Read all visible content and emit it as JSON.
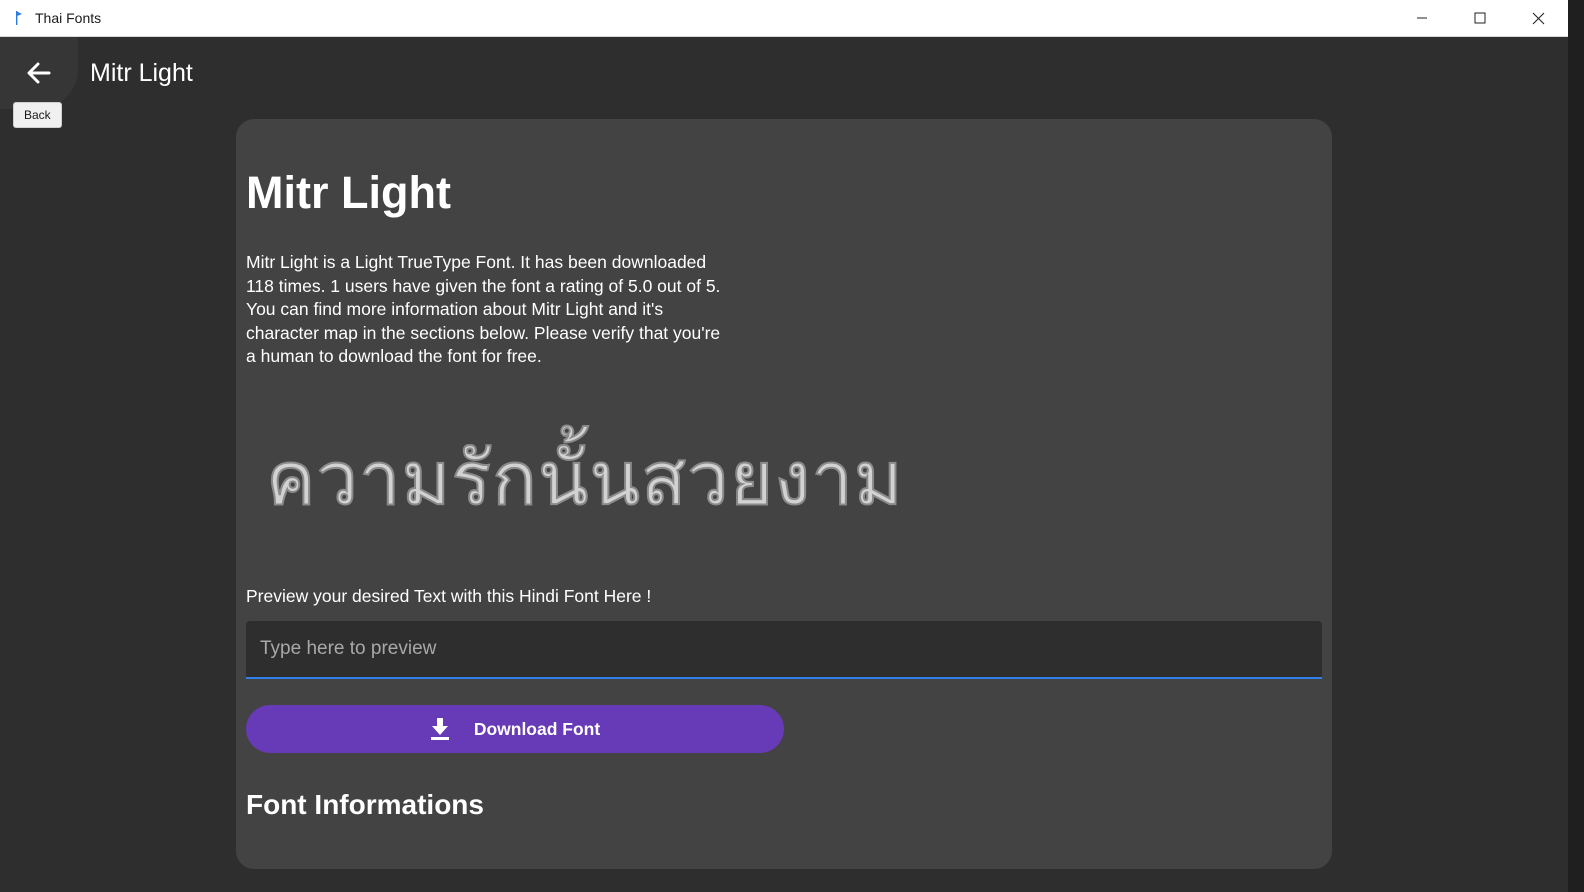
{
  "window": {
    "title": "Thai Fonts",
    "icon": "app-icon",
    "controls": [
      "minimize-icon",
      "maximize-icon",
      "close-icon"
    ]
  },
  "header": {
    "back_icon": "arrow-left-icon",
    "back_tooltip": "Back",
    "page_title": "Mitr Light"
  },
  "card": {
    "font_title": "Mitr Light",
    "description": "Mitr Light is a Light TrueType Font. It has been downloaded 118 times. 1 users have given the font a rating of 5.0 out of 5. You can find more information about Mitr Light and it's character map in the sections below. Please verify that you're a human to download the font for free.",
    "sample_text": "ความรักนั้นสวยงาม",
    "preview_label": "Preview your desired Text with this Hindi Font Here !",
    "preview_input": {
      "value": "",
      "placeholder": "Type here to preview"
    },
    "download": {
      "icon": "download-icon",
      "label": "Download Font"
    },
    "section_heading": "Font Informations"
  },
  "colors": {
    "background": "#2e2e2e",
    "card": "#434343",
    "accent_button": "#673ab7",
    "input_underline": "#2f80ed"
  }
}
